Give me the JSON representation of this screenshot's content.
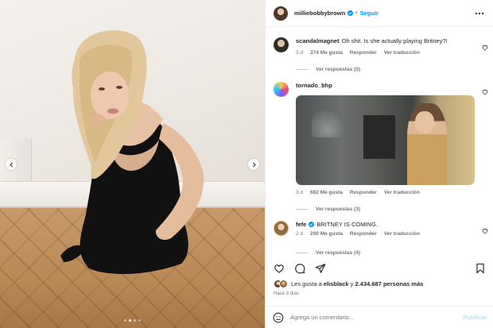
{
  "post": {
    "author": "milliebobbybrown",
    "separator": "•",
    "follow_label": "Seguir",
    "more_icon": "more-horizontal-icon",
    "verified_color": "#0095f6"
  },
  "photo": {
    "dot_count": 4,
    "active_dot": 1
  },
  "comments": [
    {
      "user": "scandalmagnet",
      "text": "Oh shit. Is she actually playing Britney?!",
      "time": "3 d",
      "likes": "374 Me gusta",
      "reply": "Responder",
      "translate": "Ver traducción",
      "replies": "Ver respuestas (5)"
    },
    {
      "user": "tornado_bhp",
      "text": "",
      "time": "3 d",
      "likes": "682 Me gusta",
      "reply": "Responder",
      "translate": "Ver traducción",
      "replies": "Ver respuestas (3)"
    },
    {
      "user": "fefe",
      "text": "BRITNEY IS COMING.",
      "time": "2 d",
      "likes": "200 Me gusta",
      "reply": "Responder",
      "translate": "Ver traducción",
      "replies": "Ver respuestas (4)"
    }
  ],
  "likes_summary": {
    "prefix": "Les gusta a",
    "user": "elisblack",
    "conjunction": "y",
    "count": "2.434.687 personas más"
  },
  "time_ago": "Hace 3 días",
  "add_comment": {
    "placeholder": "Agrega un comentario...",
    "publish_label": "Publicar"
  },
  "colors": {
    "accent": "#0095f6",
    "text": "#262626",
    "secondary": "#737373",
    "publish_disabled": "#b2dffc"
  }
}
